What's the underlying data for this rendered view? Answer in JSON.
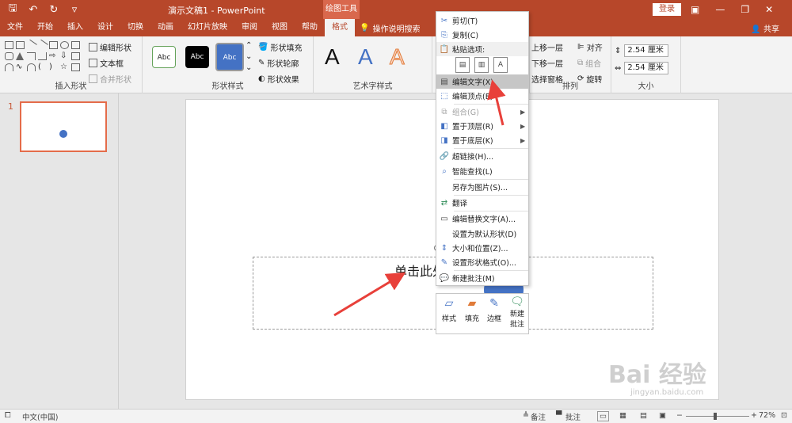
{
  "titlebar": {
    "doc_title": "演示文稿1 - PowerPoint",
    "drawing_tools": "绘图工具",
    "login": "登录"
  },
  "tabs": {
    "items": [
      "文件",
      "开始",
      "插入",
      "设计",
      "切换",
      "动画",
      "幻灯片放映",
      "审阅",
      "视图",
      "帮助",
      "格式"
    ],
    "active": "格式",
    "tell_me": "操作说明搜索",
    "share": "共享"
  },
  "ribbon": {
    "insert_shapes": {
      "label": "插入形状",
      "edit_shape": "编辑形状",
      "text_box": "文本框",
      "merge_shapes": "合并形状"
    },
    "shape_styles": {
      "label": "形状样式",
      "samples": [
        "Abc",
        "Abc",
        "Abc"
      ],
      "fill": "形状填充",
      "outline": "形状轮廓",
      "effects": "形状效果"
    },
    "wordart": {
      "label": "艺术字样式",
      "letters": [
        "A",
        "A",
        "A"
      ]
    },
    "arrange": {
      "label": "排列",
      "bring_forward": "上移一层",
      "send_backward": "下移一层",
      "selection_pane": "选择窗格",
      "align": "对齐",
      "group": "组合",
      "rotate": "旋转"
    },
    "size": {
      "label": "大小",
      "height": "2.54 厘米",
      "width": "2.54 厘米"
    }
  },
  "thumbs": {
    "slide_number": "1"
  },
  "slide": {
    "placeholder_text": "单击此处"
  },
  "context_menu": {
    "cut": "剪切(T)",
    "copy": "复制(C)",
    "paste_options": "粘贴选项:",
    "edit_text": "编辑文字(X)",
    "edit_points": "编辑顶点(E)",
    "group": "组合(G)",
    "bring_to_front": "置于顶层(R)",
    "send_to_back": "置于底层(K)",
    "hyperlink": "超链接(H)...",
    "smart_lookup": "智能查找(L)",
    "save_as_picture": "另存为图片(S)...",
    "translate": "翻译",
    "alt_text": "编辑替换文字(A)...",
    "set_default": "设置为默认形状(D)",
    "size_position": "大小和位置(Z)...",
    "format_shape": "设置形状格式(O)...",
    "new_comment": "新建批注(M)"
  },
  "minibar": {
    "style": "样式",
    "fill": "填充",
    "outline": "边框",
    "new_comment_1": "新建",
    "new_comment_2": "批注"
  },
  "statusbar": {
    "language": "中文(中国)",
    "notes": "备注",
    "comments": "批注",
    "zoom": "72%"
  },
  "watermark": {
    "brand": "Bai 经验",
    "url": "jingyan.baidu.com"
  },
  "colors": {
    "accent": "#b7472a",
    "shape_fill": "#4472c4",
    "annotation_arrow": "#e8403a"
  }
}
